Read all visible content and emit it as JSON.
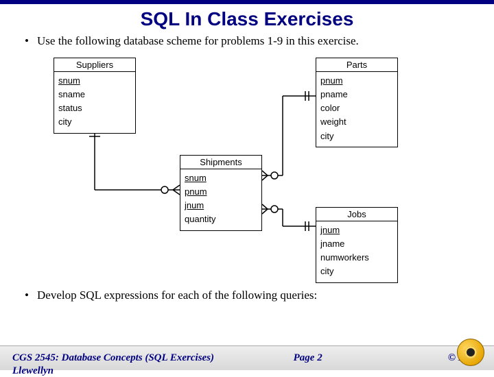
{
  "title": "SQL In Class Exercises",
  "bullets": [
    "Use the following database scheme for problems 1-9 in this exercise.",
    "Develop SQL expressions for each of the following queries:"
  ],
  "entities": {
    "suppliers": {
      "name": "Suppliers",
      "attrs": [
        {
          "name": "snum",
          "key": true
        },
        {
          "name": "sname",
          "key": false
        },
        {
          "name": "status",
          "key": false
        },
        {
          "name": "city",
          "key": false
        }
      ]
    },
    "parts": {
      "name": "Parts",
      "attrs": [
        {
          "name": "pnum",
          "key": true
        },
        {
          "name": "pname",
          "key": false
        },
        {
          "name": "color",
          "key": false
        },
        {
          "name": "weight",
          "key": false
        },
        {
          "name": "city",
          "key": false
        }
      ]
    },
    "shipments": {
      "name": "Shipments",
      "attrs": [
        {
          "name": "snum",
          "key": true
        },
        {
          "name": "pnum",
          "key": true
        },
        {
          "name": "jnum",
          "key": true
        },
        {
          "name": "quantity",
          "key": false
        }
      ]
    },
    "jobs": {
      "name": "Jobs",
      "attrs": [
        {
          "name": "jnum",
          "key": true
        },
        {
          "name": "jname",
          "key": false
        },
        {
          "name": "numworkers",
          "key": false
        },
        {
          "name": "city",
          "key": false
        }
      ]
    }
  },
  "footer": {
    "course": "CGS 2545: Database Concepts  (SQL Exercises)",
    "page": "Page 2",
    "copyright": "© Mark",
    "cutoff_name": "Llewellyn"
  }
}
